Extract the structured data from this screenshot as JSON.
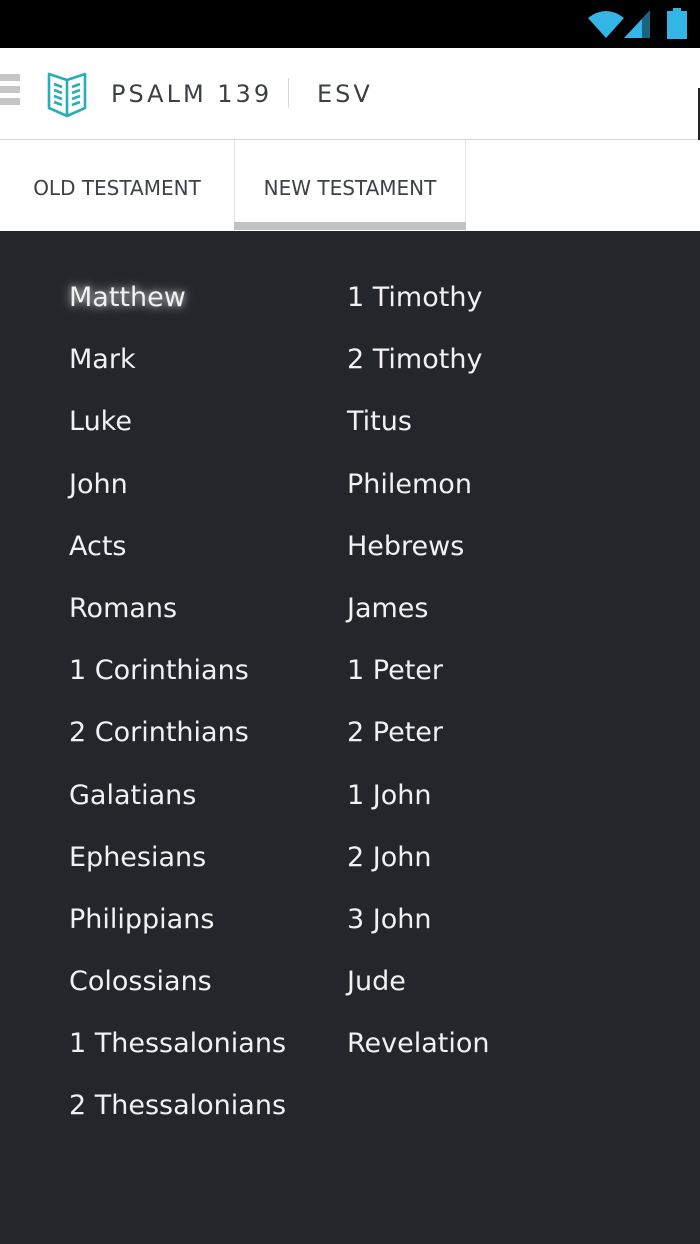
{
  "header": {
    "title": "PSALM 139",
    "version": "ESV"
  },
  "tabs": [
    {
      "label": "OLD TESTAMENT",
      "selected": false
    },
    {
      "label": "NEW TESTAMENT",
      "selected": true
    }
  ],
  "books": {
    "left": [
      "Matthew",
      "Mark",
      "Luke",
      "John",
      "Acts",
      "Romans",
      "1 Corinthians",
      "2 Corinthians",
      "Galatians",
      "Ephesians",
      "Philippians",
      "Colossians",
      "1 Thessalonians",
      "2 Thessalonians"
    ],
    "right": [
      "1 Timothy",
      "2 Timothy",
      "Titus",
      "Philemon",
      "Hebrews",
      "James",
      "1 Peter",
      "2 Peter",
      "1 John",
      "2 John",
      "3 John",
      "Jude",
      "Revelation"
    ]
  },
  "selected_book": "Matthew",
  "colors": {
    "accent": "#27aeb7",
    "background": "#23262b",
    "status_icon": "#33b5e5"
  },
  "icons": [
    "wifi-icon",
    "signal-icon",
    "battery-icon",
    "menu-icon",
    "book-icon"
  ]
}
